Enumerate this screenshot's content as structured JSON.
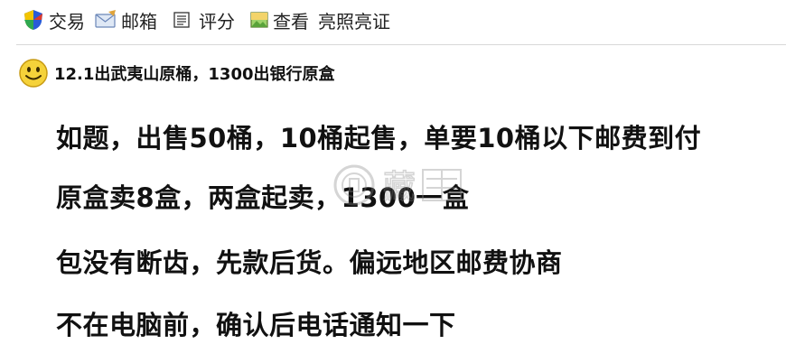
{
  "toolbar": {
    "trade_label": "交易",
    "mailbox_label": "邮箱",
    "rate_label": "评分",
    "view_label": "查看",
    "license_label": "亮照亮证"
  },
  "thread": {
    "title": "12.1出武夷山原桶，1300出银行原盒"
  },
  "post": {
    "lines": [
      "如题，出售50桶，10桶起售，单要10桶以下邮费到付",
      "原盒卖8盒，两盒起卖，1300一盒",
      "包没有断齿，先款后货。偏远地区邮费协商",
      "不在电脑前，确认后电话通知一下"
    ]
  },
  "watermark": {
    "text": "藏"
  },
  "icons": {
    "trade": "shield-icon",
    "mailbox": "envelope-icon",
    "rate": "document-icon",
    "view": "picture-icon",
    "smiley": "smiley-face-icon"
  },
  "colors": {
    "shield_blue": "#2a5bd7",
    "shield_yellow": "#f2c400",
    "smiley_yellow": "#f5d23a",
    "divider": "#d8d8d8"
  }
}
